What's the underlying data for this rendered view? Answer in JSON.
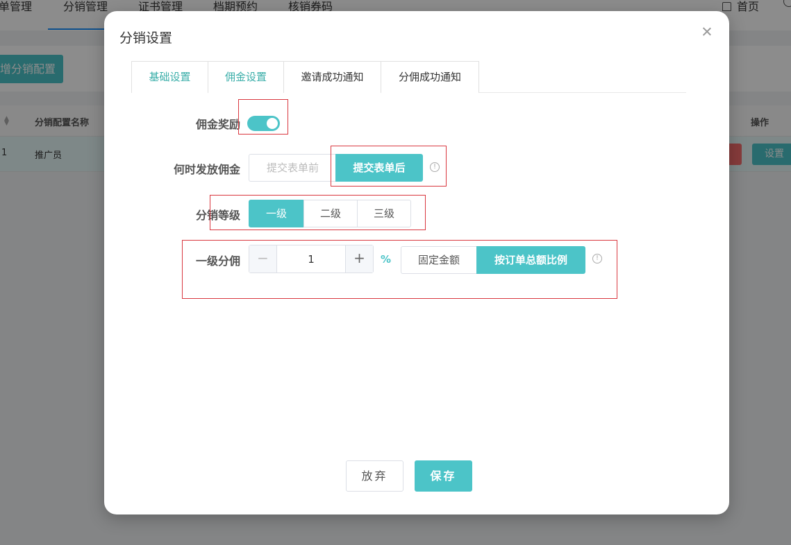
{
  "background": {
    "nav": [
      "单管理",
      "分销管理",
      "证书管理",
      "档期预约",
      "核销券码"
    ],
    "home_label": "首页",
    "add_button": "增分销配置",
    "table": {
      "headers": {
        "name": "分销配置名称",
        "actions": "操作"
      },
      "rows": [
        {
          "index": "1",
          "name": "推广员",
          "action_set": "设置"
        }
      ]
    }
  },
  "modal": {
    "title": "分销设置",
    "tabs": [
      "基础设置",
      "佣金设置",
      "邀请成功通知",
      "分佣成功通知"
    ],
    "active_tab_index": 1,
    "commission_reward": {
      "label": "佣金奖励",
      "enabled": true
    },
    "payout_timing": {
      "label": "何时发放佣金",
      "options": [
        "提交表单前",
        "提交表单后"
      ],
      "selected": "提交表单后"
    },
    "level": {
      "label": "分销等级",
      "options": [
        "一级",
        "二级",
        "三级"
      ],
      "selected": "一级"
    },
    "first_level_commission": {
      "label": "一级分佣",
      "value": "1",
      "minus": "−",
      "plus": "+",
      "unit": "%",
      "modes": [
        "固定金额",
        "按订单总额比例"
      ],
      "selected_mode": "按订单总额比例"
    },
    "footer": {
      "cancel": "放弃",
      "save": "保存"
    }
  },
  "colors": {
    "accent": "#4cc4c8",
    "highlight": "#d9363e",
    "danger": "#f56c6c"
  }
}
